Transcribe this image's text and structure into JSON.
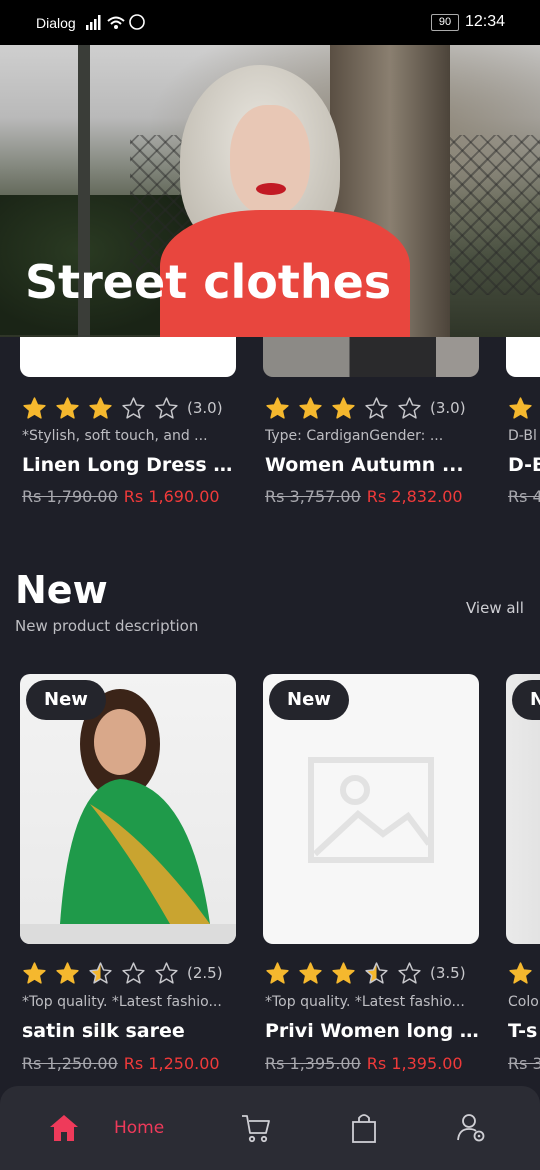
{
  "status_bar": {
    "carrier": "Dialog",
    "battery": "90",
    "time": "12:34"
  },
  "hero": {
    "title": "Street clothes"
  },
  "sale_row": {
    "products": [
      {
        "rating_text": "(3.0)",
        "rating": 3.0,
        "description": "*Stylish, soft touch, and ...",
        "title": "Linen Long Dress / ...",
        "old_price": "Rs 1,790.00",
        "price": "Rs 1,690.00"
      },
      {
        "rating_text": "(3.0)",
        "rating": 3.0,
        "description": "Type: CardiganGender: ...",
        "title": "Women Autumn ...",
        "old_price": "Rs 3,757.00",
        "price": "Rs 2,832.00"
      },
      {
        "rating_text": "",
        "rating": 1.0,
        "description": "D-Bl",
        "title": "D-B",
        "old_price": "Rs 4",
        "price": ""
      }
    ]
  },
  "new_section": {
    "title": "New",
    "subtitle": "New product description",
    "view_all": "View all",
    "products": [
      {
        "badge": "New",
        "rating_text": "(2.5)",
        "rating": 2.5,
        "description": "*Top quality. *Latest fashio...",
        "title": "satin silk saree",
        "old_price": "Rs 1,250.00",
        "price": "Rs 1,250.00"
      },
      {
        "badge": "New",
        "rating_text": "(3.5)",
        "rating": 3.5,
        "description": "*Top quality. *Latest fashio...",
        "title": "Privi Women long ...",
        "old_price": "Rs 1,395.00",
        "price": "Rs 1,395.00"
      },
      {
        "badge": "N",
        "rating_text": "",
        "rating": 1.0,
        "description": "Colo",
        "title": "T-s",
        "old_price": "Rs 3",
        "price": ""
      }
    ]
  },
  "bottom_nav": {
    "home_label": "Home",
    "colors": {
      "active": "#ef3a5a",
      "inactive": "#cfcfd4"
    },
    "icons": [
      "home-icon",
      "cart-icon",
      "bag-icon",
      "user-settings-icon"
    ]
  },
  "colors": {
    "star": "#f5b82e",
    "price_red": "#ef3a3a",
    "background": "#1e1f28"
  }
}
